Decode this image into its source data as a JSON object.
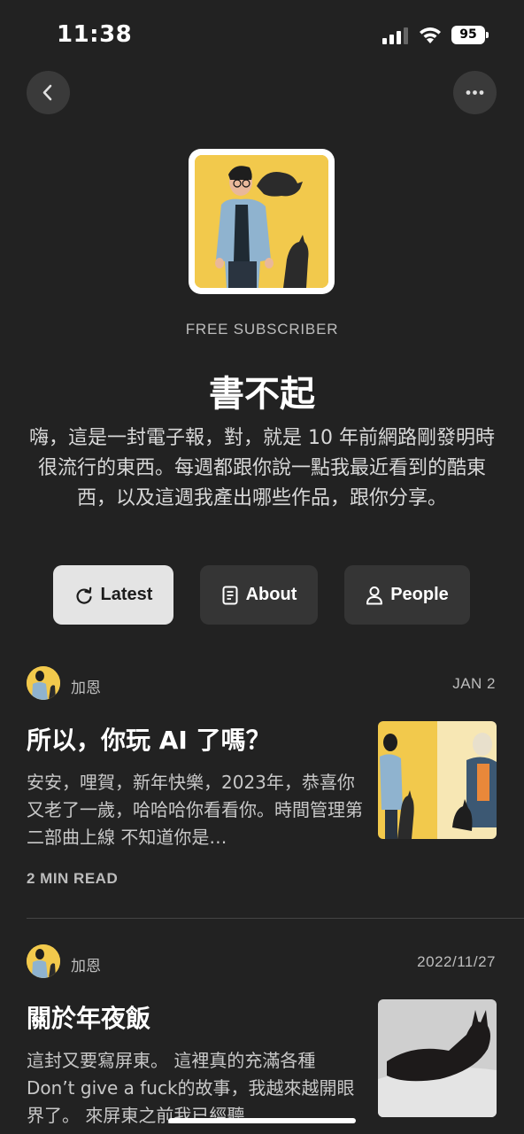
{
  "status_bar": {
    "time": "11:38",
    "battery": "95"
  },
  "profile": {
    "badge": "FREE SUBSCRIBER",
    "title": "書不起",
    "description": "嗨，這是一封電子報，對，就是 10 年前網路剛發明時很流行的東西。每週都跟你說一點我最近看到的酷東西，以及這週我產出哪些作品，跟你分享。"
  },
  "tabs": [
    {
      "label": "Latest",
      "icon": "refresh-icon",
      "active": true
    },
    {
      "label": "About",
      "icon": "document-icon",
      "active": false
    },
    {
      "label": "People",
      "icon": "person-icon",
      "active": false
    }
  ],
  "posts": [
    {
      "author": "加恩",
      "date": "JAN 2",
      "title": "所以，你玩 AI 了嗎？",
      "excerpt": "安安，哩賀，新年快樂，2023年，恭喜你又老了一歲，哈哈哈你看看你。時間管理第二部曲上線 不知道你是…",
      "read_time": "2 MIN READ"
    },
    {
      "author": "加恩",
      "date": "2022/11/27",
      "title": "關於年夜飯",
      "excerpt": "這封又要寫屏東。 這裡真的充滿各種Don’t give a fuck的故事，我越來越開眼界了。 來屏東之前我已經聽"
    }
  ],
  "colors": {
    "background": "#222222",
    "accent_yellow": "#f2c94c",
    "button_active": "#e4e4e4",
    "button": "#353535"
  }
}
